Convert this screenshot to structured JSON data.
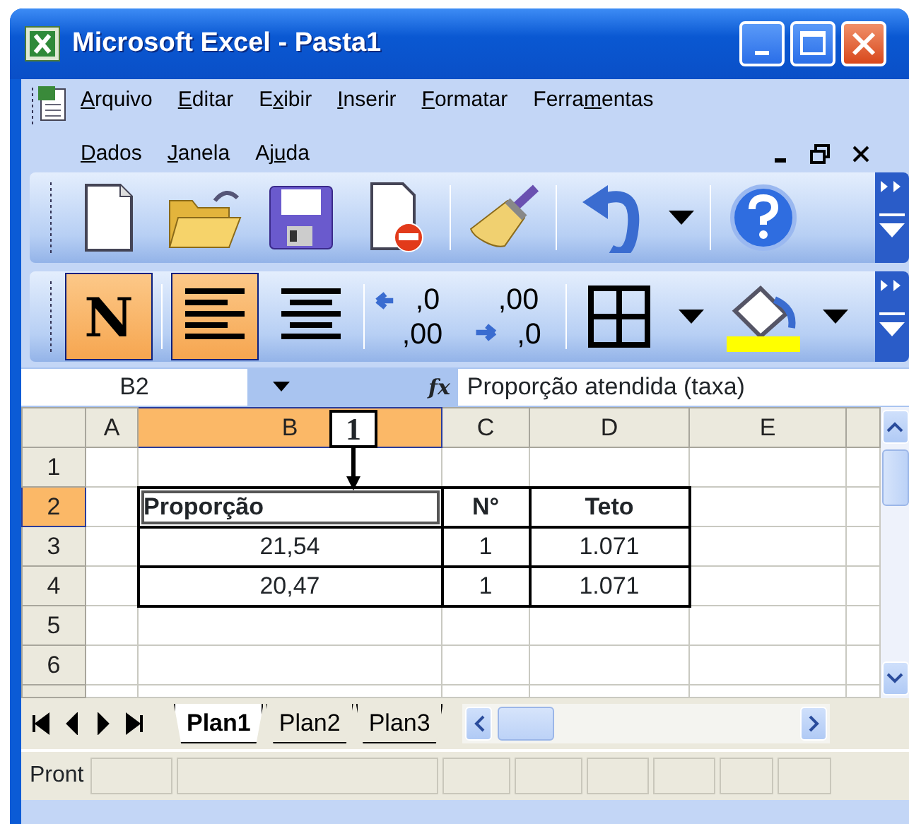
{
  "window": {
    "title": "Microsoft Excel - Pasta1"
  },
  "menu": [
    {
      "key": "A",
      "post": "rquivo"
    },
    {
      "key": "E",
      "post": "ditar"
    },
    {
      "pre": "E",
      "key": "x",
      "post": "ibir"
    },
    {
      "key": "I",
      "post": "nserir"
    },
    {
      "key": "F",
      "post": "ormatar"
    },
    {
      "pre": "Ferra",
      "key": "m",
      "post": "entas"
    },
    {
      "key": "D",
      "post": "ados"
    },
    {
      "key": "J",
      "post": "anela"
    },
    {
      "pre": "Aj",
      "key": "u",
      "post": "da"
    }
  ],
  "toolbar_standard": [
    {
      "kind": "new"
    },
    {
      "kind": "open"
    },
    {
      "kind": "save"
    },
    {
      "kind": "permission"
    },
    {
      "kind": "sep"
    },
    {
      "kind": "brush"
    },
    {
      "kind": "sep"
    },
    {
      "kind": "undo"
    },
    {
      "kind": "dropdown"
    },
    {
      "kind": "sep"
    },
    {
      "kind": "help"
    }
  ],
  "toolbar_format": [
    {
      "kind": "bold",
      "label": "N",
      "pressed": true
    },
    {
      "kind": "sep"
    },
    {
      "kind": "align-left",
      "pressed": true
    },
    {
      "kind": "align-center",
      "pressed": false
    },
    {
      "kind": "sep"
    },
    {
      "kind": "decimal-add",
      "top": ",0",
      "bottom": ",00"
    },
    {
      "kind": "decimal-remove",
      "top": ",00",
      "bottom": ",0"
    },
    {
      "kind": "sep"
    },
    {
      "kind": "borders"
    },
    {
      "kind": "dropdown"
    },
    {
      "kind": "fill"
    },
    {
      "kind": "dropdown"
    }
  ],
  "formula_bar": {
    "name_box": "B2",
    "fx": "fx",
    "formula": "Proporção atendida (taxa)"
  },
  "columns": [
    {
      "label": "A",
      "selected": false
    },
    {
      "label": "B",
      "selected": true
    },
    {
      "label": "C",
      "selected": false
    },
    {
      "label": "D",
      "selected": false
    },
    {
      "label": "E",
      "selected": false
    }
  ],
  "callout": {
    "label": "1"
  },
  "rows": [
    {
      "header": "1",
      "selected": false,
      "cells": [
        {},
        {},
        {},
        {},
        {}
      ]
    },
    {
      "header": "2",
      "selected": true,
      "cells": [
        {},
        {
          "text": "Proporção",
          "bold": true,
          "left_aligned": true,
          "boxed": true,
          "active": true
        },
        {
          "text": "N°",
          "bold": true,
          "boxed": true
        },
        {
          "text": "Teto",
          "bold": true,
          "boxed": true
        },
        {}
      ]
    },
    {
      "header": "3",
      "selected": false,
      "cells": [
        {},
        {
          "text": "21,54",
          "boxed": true
        },
        {
          "text": "1",
          "boxed": true
        },
        {
          "text": "1.071",
          "boxed": true
        },
        {}
      ]
    },
    {
      "header": "4",
      "selected": false,
      "cells": [
        {},
        {
          "text": "20,47",
          "boxed": true
        },
        {
          "text": "1",
          "boxed": true
        },
        {
          "text": "1.071",
          "boxed": true
        },
        {}
      ]
    },
    {
      "header": "5",
      "selected": false,
      "cells": [
        {},
        {},
        {},
        {},
        {}
      ]
    },
    {
      "header": "6",
      "selected": false,
      "cells": [
        {},
        {},
        {},
        {},
        {}
      ]
    },
    {
      "selected": false,
      "cells": [
        {},
        {},
        {},
        {},
        {}
      ]
    }
  ],
  "sheet_tabs": [
    {
      "label": "Plan1",
      "selected": true
    },
    {
      "label": "Plan2",
      "selected": false
    },
    {
      "label": "Plan3",
      "selected": false
    }
  ],
  "status_bar": {
    "text": "Pront"
  }
}
